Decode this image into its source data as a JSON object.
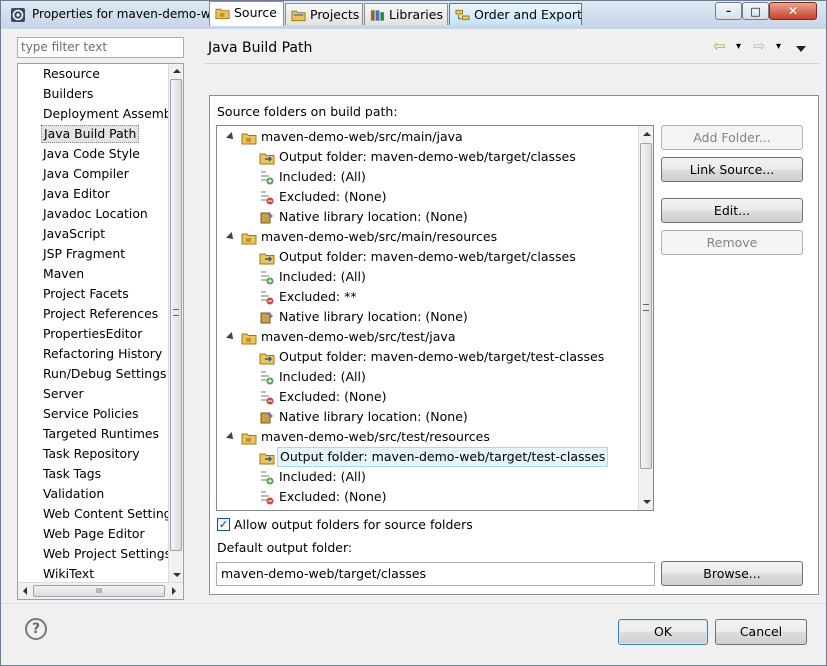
{
  "window": {
    "title": "Properties for maven-demo-web",
    "minimize": "–",
    "maximize": "□",
    "close": "✕"
  },
  "filter": {
    "placeholder": "type filter text"
  },
  "nav": {
    "selected": "Java Build Path",
    "items": [
      "Resource",
      "Builders",
      "Deployment Assembly",
      "Java Build Path",
      "Java Code Style",
      "Java Compiler",
      "Java Editor",
      "Javadoc Location",
      "JavaScript",
      "JSP Fragment",
      "Maven",
      "Project Facets",
      "Project References",
      "PropertiesEditor",
      "Refactoring History",
      "Run/Debug Settings",
      "Server",
      "Service Policies",
      "Targeted Runtimes",
      "Task Repository",
      "Task Tags",
      "Validation",
      "Web Content Settings",
      "Web Page Editor",
      "Web Project Settings",
      "WikiText"
    ],
    "hscroll_grip": "III"
  },
  "page": {
    "title": "Java Build Path",
    "back": "⇦",
    "forward": "⇨",
    "menu": "▾"
  },
  "tabs": [
    {
      "label": "Source",
      "active": true,
      "icon": "source-folder-icon"
    },
    {
      "label": "Projects",
      "active": false,
      "icon": "projects-icon"
    },
    {
      "label": "Libraries",
      "active": false,
      "icon": "libraries-icon"
    },
    {
      "label": "Order and Export",
      "active": false,
      "icon": "order-export-icon"
    }
  ],
  "source": {
    "heading": "Source folders on build path:",
    "folders": [
      {
        "path": "maven-demo-web/src/main/java",
        "children": [
          {
            "kind": "output",
            "text": "Output folder: maven-demo-web/target/classes"
          },
          {
            "kind": "included",
            "text": "Included: (All)"
          },
          {
            "kind": "excluded",
            "text": "Excluded: (None)"
          },
          {
            "kind": "native",
            "text": "Native library location: (None)"
          }
        ]
      },
      {
        "path": "maven-demo-web/src/main/resources",
        "children": [
          {
            "kind": "output",
            "text": "Output folder: maven-demo-web/target/classes"
          },
          {
            "kind": "included",
            "text": "Included: (All)"
          },
          {
            "kind": "excluded",
            "text": "Excluded: **"
          },
          {
            "kind": "native",
            "text": "Native library location: (None)"
          }
        ]
      },
      {
        "path": "maven-demo-web/src/test/java",
        "children": [
          {
            "kind": "output",
            "text": "Output folder: maven-demo-web/target/test-classes"
          },
          {
            "kind": "included",
            "text": "Included: (All)"
          },
          {
            "kind": "excluded",
            "text": "Excluded: (None)"
          },
          {
            "kind": "native",
            "text": "Native library location: (None)"
          }
        ]
      },
      {
        "path": "maven-demo-web/src/test/resources",
        "children": [
          {
            "kind": "output",
            "text": "Output folder: maven-demo-web/target/test-classes",
            "selected": true
          },
          {
            "kind": "included",
            "text": "Included: (All)"
          },
          {
            "kind": "excluded",
            "text": "Excluded: (None)"
          }
        ]
      }
    ],
    "buttons": {
      "add_folder": "Add Folder...",
      "link_source": "Link Source...",
      "edit": "Edit...",
      "remove": "Remove"
    },
    "allow_output_label": "Allow output folders for source folders",
    "allow_output_checked": true,
    "default_output_label": "Default output folder:",
    "default_output_value": "maven-demo-web/target/classes",
    "browse": "Browse..."
  },
  "footer": {
    "ok": "OK",
    "cancel": "Cancel",
    "help": "?"
  },
  "colors": {
    "selection": "#e5f3fb",
    "selection_border": "#a8d8f5",
    "default_button_border": "#3c7fb1"
  }
}
